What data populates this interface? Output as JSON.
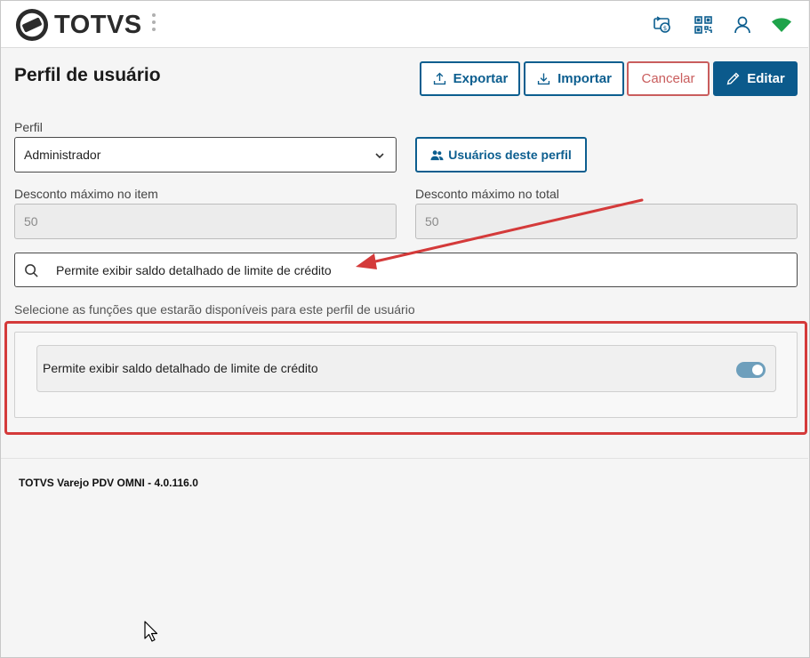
{
  "header": {
    "brand": "TOTVS",
    "icons": [
      "money-transfer-icon",
      "qr-code-icon",
      "user-icon",
      "wifi-icon"
    ],
    "wifi_color": "#1ea34a"
  },
  "page": {
    "title": "Perfil de usuário"
  },
  "toolbar": {
    "export_label": "Exportar",
    "import_label": "Importar",
    "cancel_label": "Cancelar",
    "edit_label": "Editar"
  },
  "form": {
    "profile_label": "Perfil",
    "profile_value": "Administrador",
    "users_button_label": "Usuários deste perfil",
    "item_discount_label": "Desconto máximo no item",
    "item_discount_value": "50",
    "total_discount_label": "Desconto máximo no total",
    "total_discount_value": "50",
    "search_value": "Permite exibir saldo detalhado de limite de crédito"
  },
  "functions": {
    "instructions": "Selecione as funções que estarão disponíveis para este perfil de usuário",
    "items": [
      {
        "label": "Permite exibir saldo detalhado de limite de crédito",
        "enabled": true
      }
    ]
  },
  "footer": {
    "version": "TOTVS Varejo PDV OMNI - 4.0.116.0"
  },
  "colors": {
    "primary": "#0b5a8c",
    "danger": "#c95d5d",
    "highlight": "#d43a3a",
    "toggle_on": "#6e9fbc"
  }
}
